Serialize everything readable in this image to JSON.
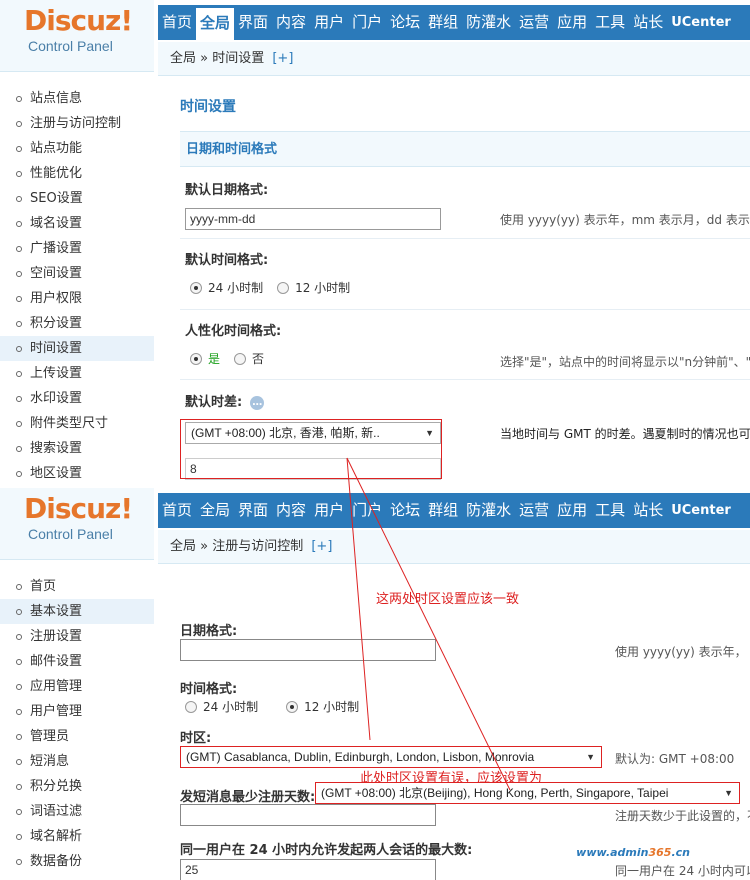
{
  "panel_top": {
    "logo_main": "Discuz",
    "logo_excl": "!",
    "logo_sub": "Control Panel",
    "nav": [
      "首页",
      "全局",
      "界面",
      "内容",
      "用户",
      "门户",
      "论坛",
      "群组",
      "防灌水",
      "运营",
      "应用",
      "工具",
      "站长",
      "UCenter"
    ],
    "active_nav": "全局",
    "breadcrumb": "全局 » 时间设置",
    "breadcrumb_plus": "[+]",
    "sidebar": [
      "站点信息",
      "注册与访问控制",
      "站点功能",
      "性能优化",
      "SEO设置",
      "域名设置",
      "广播设置",
      "空间设置",
      "用户权限",
      "积分设置",
      "时间设置",
      "上传设置",
      "水印设置",
      "附件类型尺寸",
      "搜索设置",
      "地区设置"
    ],
    "active_sidebar": "时间设置",
    "page_title": "时间设置",
    "section_title": "日期和时间格式",
    "date_format_label": "默认日期格式:",
    "date_format_value": "yyyy-mm-dd",
    "date_format_hint": "使用 yyyy(yy) 表示年，mm 表示月，dd 表示",
    "time_format_label": "默认时间格式:",
    "time_format_options": [
      "24 小时制",
      "12 小时制"
    ],
    "time_format_selected": "24 小时制",
    "humanize_label": "人性化时间格式:",
    "humanize_options": [
      "是",
      "否"
    ],
    "humanize_selected": "是",
    "humanize_hint": "选择\"是\"，站点中的时间将显示以\"n分钟前\"、\"",
    "timezone_label": "默认时差:",
    "timezone_value": "(GMT +08:00) 北京, 香港, 帕斯, 新..",
    "timezone_hint": "当地时间与 GMT 的时差。遇夏制时的情况也可",
    "timezone_input": "8"
  },
  "panel_bottom": {
    "logo_main": "Discuz",
    "logo_excl": "!",
    "logo_sub": "Control Panel",
    "nav": [
      "首页",
      "全局",
      "界面",
      "内容",
      "用户",
      "门户",
      "论坛",
      "群组",
      "防灌水",
      "运营",
      "应用",
      "工具",
      "站长",
      "UCenter"
    ],
    "active_nav": "UCenter",
    "breadcrumb": "全局 » 注册与访问控制",
    "breadcrumb_plus": "[+]",
    "sidebar": [
      "首页",
      "基本设置",
      "注册设置",
      "邮件设置",
      "应用管理",
      "用户管理",
      "管理员",
      "短消息",
      "积分兑换",
      "词语过滤",
      "域名解析",
      "数据备份"
    ],
    "active_sidebar": "基本设置",
    "annotation_top": "这两处时区设置应该一致",
    "date_format_label": "日期格式:",
    "date_format_hint": "使用 yyyy(yy) 表示年，",
    "time_format_label": "时间格式:",
    "time_format_options": [
      "24 小时制",
      "12 小时制"
    ],
    "time_format_selected": "12 小时制",
    "timezone_label": "时区:",
    "timezone_value": "(GMT) Casablanca, Dublin, Edinburgh, London, Lisbon, Monrovia",
    "timezone_default": "默认为: GMT +08:00",
    "annotation_error": "此处时区设置有误，应该设置为",
    "correct_timezone": "(GMT +08:00) 北京(Beijing), Hong Kong, Perth, Singapore, Taipei",
    "min_days_label": "发短消息最少注册天数:",
    "min_days_hint": "注册天数少于此设置的，不",
    "max_conv_label": "同一用户在 24 小时内允许发起两人会话的最大数:",
    "max_conv_value": "25",
    "max_conv_hint": "同一用户在 24 小时内可以"
  },
  "watermark": {
    "www": "www.",
    "name": "admin",
    "num": "365",
    "tld": ".cn"
  },
  "colors": {
    "nav_blue": "#2b7aba",
    "logo_orange": "#e6762b",
    "annotation_red": "#dd2222"
  }
}
